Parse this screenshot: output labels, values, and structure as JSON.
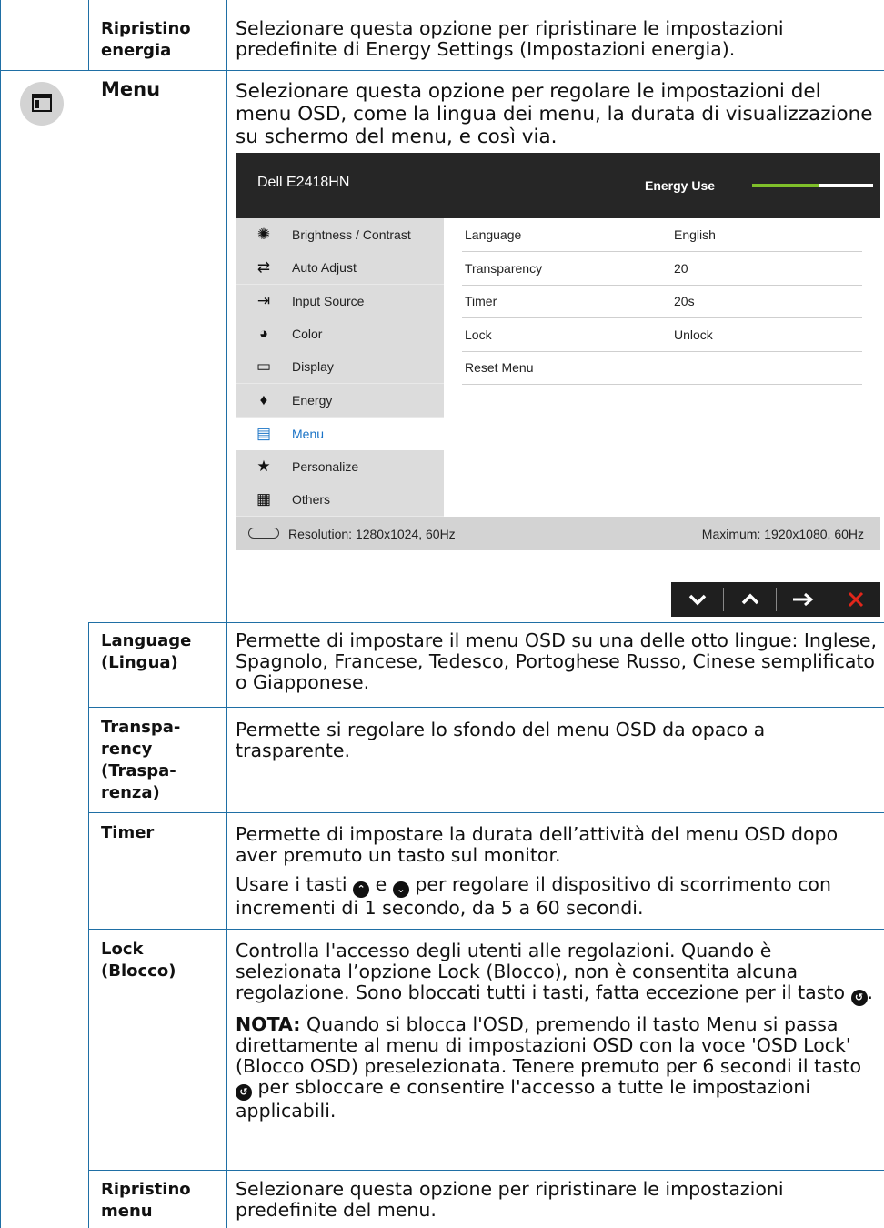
{
  "rows": {
    "ripristino_energia": {
      "label": "Ripristino energia",
      "desc": "Selezionare questa opzione per ripristinare le impostazioni predefinite di Energy Settings (Impostazioni energia)."
    },
    "menu": {
      "label": "Menu",
      "desc": "Selezionare questa opzione per regolare le impostazioni del menu OSD, come la lingua dei menu, la durata di visualizzazione su schermo del menu, e così via."
    },
    "language": {
      "label": "Language (Lingua)",
      "desc": "Permette di impostare il menu OSD su una delle otto lingue: Inglese, Spagnolo, Francese, Tedesco, Portoghese Russo, Cinese semplificato o Giapponese."
    },
    "transparency": {
      "label": "Transpa-rency (Traspa-renza)",
      "label_lines": [
        "Transpa-",
        "rency",
        "(Traspa-",
        "renza)"
      ],
      "desc": "Permette si regolare lo sfondo del menu OSD da opaco a trasparente."
    },
    "timer": {
      "label": "Timer",
      "desc1": "Permette di impostare la durata dell’attività del menu OSD dopo aver premuto un tasto sul monitor.",
      "desc2_pre": "Usare i tasti",
      "desc2_mid": "e",
      "desc2_post": "per regolare il dispositivo di scorrimento con incrementi di 1 secondo, da 5 a 60 secondi."
    },
    "lock": {
      "label": "Lock (Blocco)",
      "desc1_pre": "Controlla l'accesso degli utenti alle regolazioni. Quando è selezionata l’opzione Lock (Blocco), non è consentita alcuna regolazione. Sono bloccati tutti i tasti, fatta eccezione per il tasto",
      "desc1_post": ".",
      "note_label": "NOTA:",
      "note_pre": "Quando si blocca l'OSD, premendo il tasto Menu si passa direttamente al menu di impostazioni OSD con la voce 'OSD Lock' (Blocco OSD) preselezionata. Tenere premuto per 6 secondi il tasto",
      "note_post": "per sbloccare e consentire l'accesso a tutte le impostazioni applicabili."
    },
    "ripristino_menu": {
      "label": "Ripristino menu",
      "desc": "Selezionare questa opzione per ripristinare le impostazioni predefinite del menu."
    }
  },
  "osd": {
    "title": "Dell E2418HN",
    "energy_label": "Energy Use",
    "energy_level": 0.55,
    "energy_color": "#7fbf2a",
    "menu_items": [
      {
        "label": "Brightness / Contrast",
        "icon": "brightness-icon"
      },
      {
        "label": "Auto Adjust",
        "icon": "auto-adjust-icon"
      },
      {
        "label": "Input Source",
        "icon": "input-source-icon"
      },
      {
        "label": "Color",
        "icon": "color-icon"
      },
      {
        "label": "Display",
        "icon": "display-icon"
      },
      {
        "label": "Energy",
        "icon": "energy-icon"
      },
      {
        "label": "Menu",
        "icon": "menu-icon",
        "active": true
      },
      {
        "label": "Personalize",
        "icon": "star-icon"
      },
      {
        "label": "Others",
        "icon": "others-icon"
      }
    ],
    "settings": [
      {
        "key": "Language",
        "value": "English"
      },
      {
        "key": "Transparency",
        "value": "20"
      },
      {
        "key": "Timer",
        "value": "20s"
      },
      {
        "key": "Lock",
        "value": "Unlock"
      },
      {
        "key": "Reset Menu",
        "value": ""
      }
    ],
    "resolution": "Resolution: 1280x1024, 60Hz",
    "maximum": "Maximum: 1920x1080, 60Hz"
  },
  "nav_buttons": [
    {
      "icon": "chevron-down-icon",
      "glyph": "⌄"
    },
    {
      "icon": "chevron-up-icon",
      "glyph": "⌃"
    },
    {
      "icon": "arrow-right-icon",
      "glyph": "→"
    },
    {
      "icon": "close-icon",
      "glyph": "✕"
    }
  ],
  "accent_color": "#1f6fa5"
}
